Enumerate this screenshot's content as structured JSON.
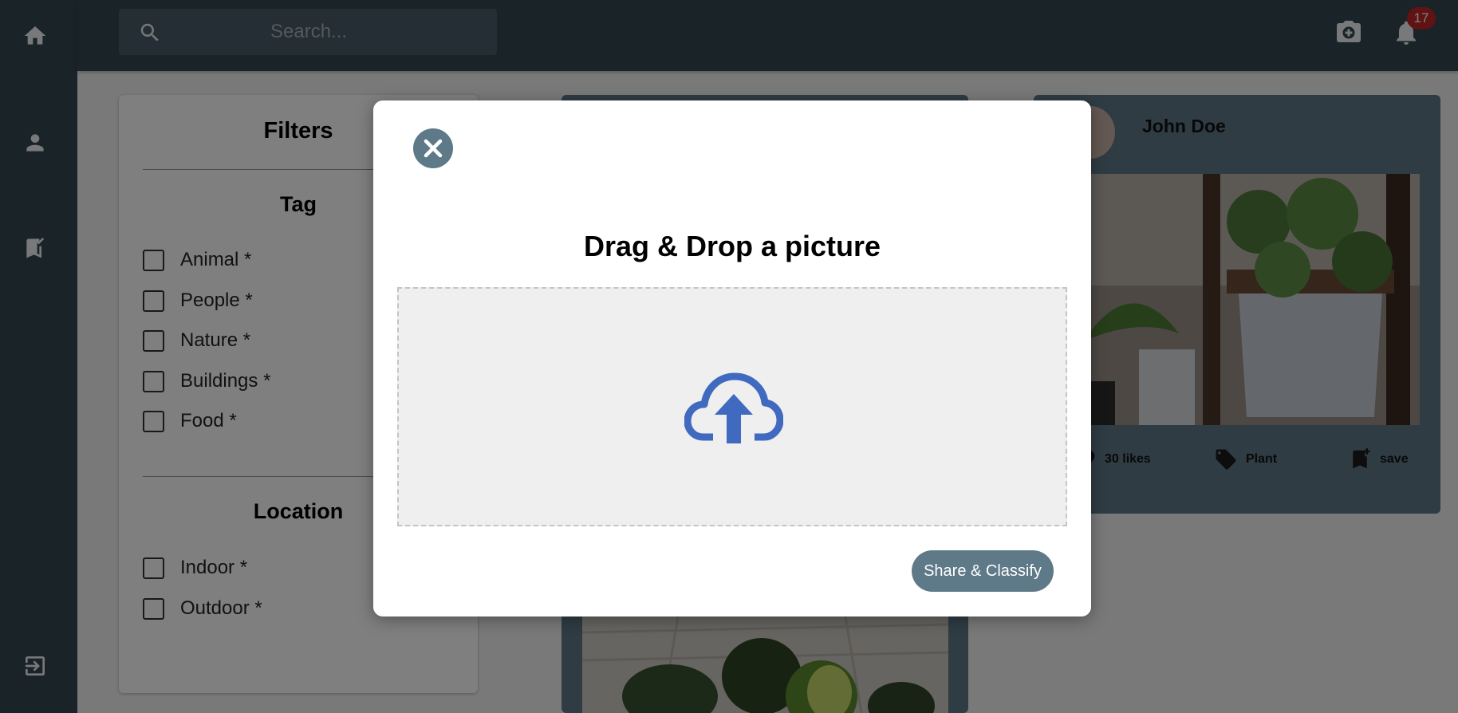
{
  "sidebar": {
    "icons": [
      "home-icon",
      "person-icon",
      "bookmark-check-icon",
      "logout-icon"
    ]
  },
  "topbar": {
    "search_placeholder": "Search...",
    "notification_count": "17",
    "icons": [
      "camera-add-icon",
      "bell-icon"
    ]
  },
  "filters": {
    "title": "Filters",
    "tag_heading": "Tag",
    "tags": [
      "Animal *",
      "People *",
      "Nature *",
      "Buildings *",
      "Food *"
    ],
    "location_heading": "Location",
    "locations": [
      "Indoor *",
      "Outdoor *"
    ]
  },
  "post": {
    "author": "John Doe",
    "likes": "30 likes",
    "tag": "Plant",
    "save": "save"
  },
  "modal": {
    "title": "Drag & Drop a picture",
    "submit_label": "Share & Classify"
  },
  "colors": {
    "nav_bg": "#334651",
    "accent": "#5e7988",
    "upload_icon": "#4069c0",
    "badge": "#c22525"
  }
}
